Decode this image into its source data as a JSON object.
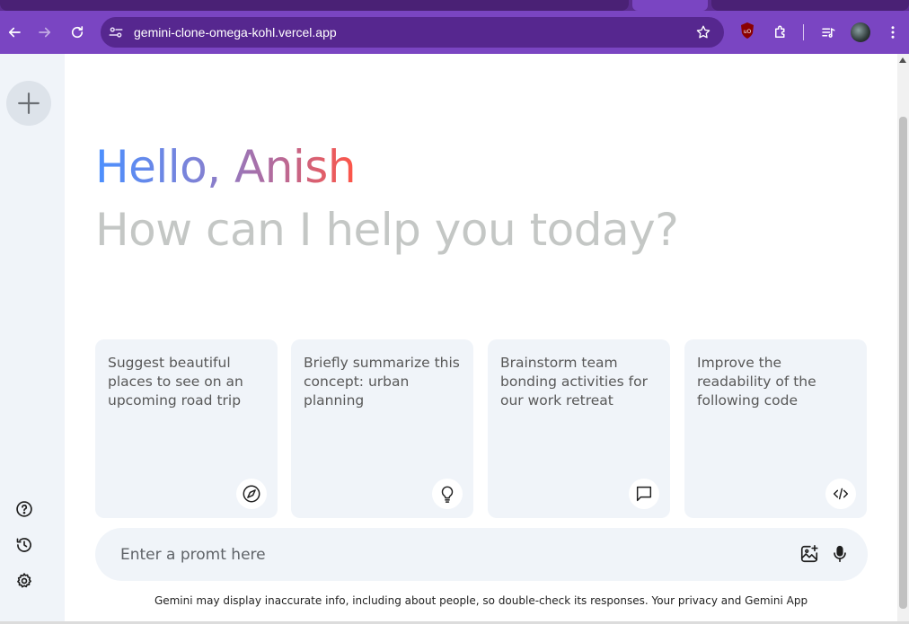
{
  "browser": {
    "url": "gemini-clone-omega-kohl.vercel.app",
    "icons": [
      "back-icon",
      "forward-icon",
      "reload-icon",
      "site-info-icon",
      "bookmark-star-icon",
      "ublock-icon",
      "extensions-icon",
      "media-control-icon",
      "profile-avatar",
      "menu-icon"
    ]
  },
  "greeting": {
    "hello": "Hello, Anish",
    "subtitle": "How can I help you today?"
  },
  "cards": [
    {
      "text": "Suggest beautiful places to see on an upcoming road trip",
      "icon": "compass-icon"
    },
    {
      "text": "Briefly summarize this concept: urban planning",
      "icon": "bulb-icon"
    },
    {
      "text": "Brainstorm team bonding activities for our work retreat",
      "icon": "message-icon"
    },
    {
      "text": "Improve the readability of the following code",
      "icon": "code-icon"
    }
  ],
  "prompt": {
    "placeholder": "Enter a promt here"
  },
  "sidebar": {
    "icons": [
      "plus-icon",
      "help-icon",
      "history-icon",
      "settings-icon"
    ]
  },
  "footer": {
    "disclaimer": "Gemini may display inaccurate info, including about people, so double-check its responses. Your privacy and Gemini App"
  },
  "colors": {
    "browser_accent": "#7a45c2",
    "sidebar_bg": "#f0f4f9",
    "gradient_start": "#4b90ff",
    "gradient_end": "#ff5546"
  }
}
